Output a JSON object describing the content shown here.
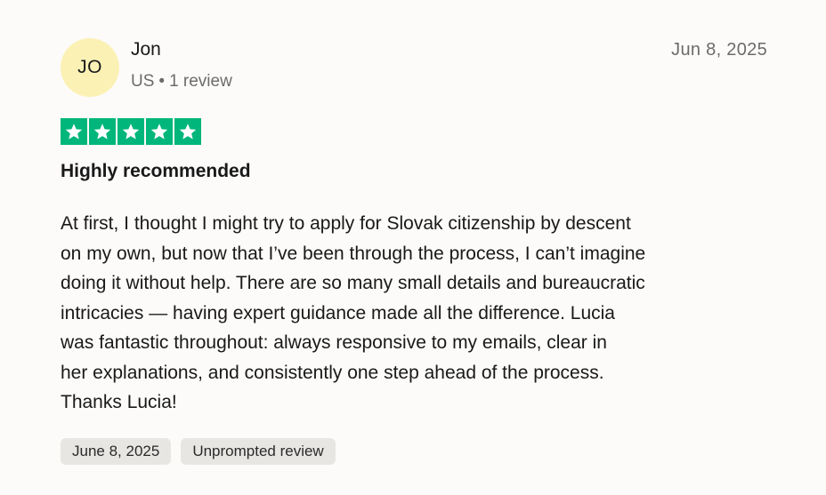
{
  "reviewer": {
    "initials": "JO",
    "name": "Jon",
    "country": "US",
    "separator": "•",
    "review_count": "1 review"
  },
  "review": {
    "date": "Jun 8, 2025",
    "rating": 5,
    "rating_max": 5,
    "star_color": "#00b67a",
    "title": "Highly recommended",
    "body_lines": [
      "At first, I thought I might try to apply for Slovak citizenship by descent",
      "on my own, but now that I’ve been through the process, I can’t imagine",
      "doing it without help. There are so many small details and bureaucratic",
      "intricacies — having expert guidance made all the difference. Lucia",
      "was fantastic throughout: always responsive to my emails, clear in",
      "her explanations, and consistently one step ahead of the process.",
      "Thanks Lucia!"
    ]
  },
  "tags": [
    "June 8, 2025",
    "Unprompted review"
  ],
  "colors": {
    "avatar_bg": "#fcf1b5",
    "tag_bg": "#e8e6e3",
    "star_green": "#00b67a"
  }
}
